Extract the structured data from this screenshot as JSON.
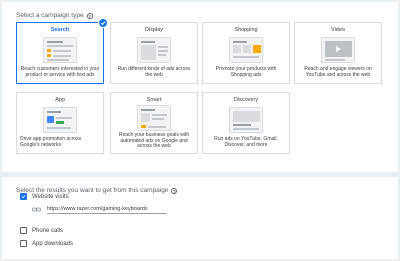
{
  "campaign_type": {
    "label": "Select a campaign type",
    "help_icon": "help-circle-icon",
    "cards": [
      {
        "key": "search",
        "title": "Search",
        "description": "Reach customers interested in your product or service with text ads",
        "selected": true
      },
      {
        "key": "display",
        "title": "Display",
        "description": "Run different kinds of ads across the web",
        "selected": false
      },
      {
        "key": "shopping",
        "title": "Shopping",
        "description": "Promote your products with Shopping ads",
        "selected": false
      },
      {
        "key": "video",
        "title": "Video",
        "description": "Reach and engage viewers on YouTube and across the web",
        "selected": false
      },
      {
        "key": "app",
        "title": "App",
        "description": "Drive app promotion across Google's networks",
        "selected": false
      },
      {
        "key": "smart",
        "title": "Smart",
        "description": "Reach your business goals with automated ads on Google and across the web",
        "selected": false
      },
      {
        "key": "discovery",
        "title": "Discovery",
        "description": "Run ads on YouTube, Gmail, Discover, and more",
        "selected": false
      }
    ]
  },
  "goals": {
    "label": "Select the results you want to get from this campaign",
    "help_icon": "help-circle-icon",
    "website_visits": {
      "label": "Website visits",
      "checked": true,
      "url_icon": "link-icon",
      "url_value": "https://www.razer.com/gaming-keyboards"
    },
    "phone_calls": {
      "label": "Phone calls",
      "checked": false
    },
    "app_downloads": {
      "label": "App downloads",
      "checked": false
    }
  },
  "colors": {
    "accent": "#1a73e8",
    "background": "#eceff1"
  }
}
